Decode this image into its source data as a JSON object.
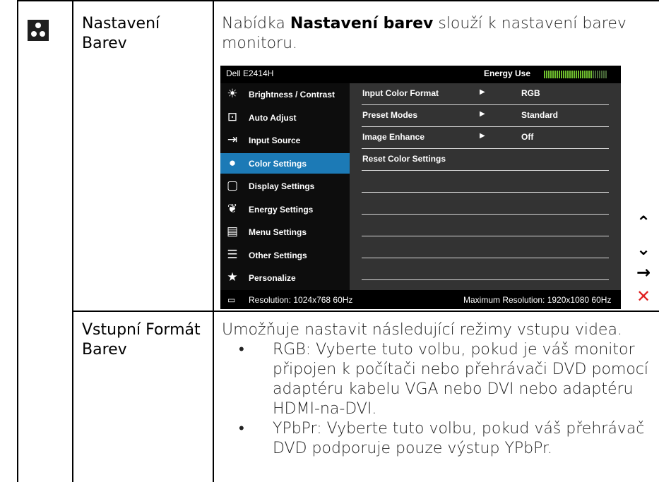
{
  "rows": [
    {
      "label": "Nastavení Barev",
      "desc_prefix": "Nabídka ",
      "desc_bold": "Nastavení barev",
      "desc_suffix": " slouží k nastavení barev monitoru."
    },
    {
      "label": "Vstupní Formát Barev",
      "desc_intro": "Umožňuje nastavit následující režimy vstupu videa.",
      "bullets": [
        "RGB: Vyberte tuto volbu, pokud je váš monitor připojen k počítači nebo přehrávači DVD pomocí adaptéru kabelu VGA nebo DVI nebo adaptéru HDMI-na-DVI.",
        "YPbPr: Vyberte tuto volbu, pokud váš přehrávač DVD podporuje pouze výstup YPbPr."
      ],
      "bullet_char": "•"
    }
  ],
  "icons": {
    "row_icon": "color-settings-icon"
  },
  "osd": {
    "model": "Dell E2414H",
    "energy_label": "Energy Use",
    "energy_level_fraction": 0.78,
    "menu": [
      {
        "label": "Brightness / Contrast",
        "icon": "brightness-icon",
        "glyph": "☀"
      },
      {
        "label": "Auto Adjust",
        "icon": "auto-adjust-icon",
        "glyph": "⊡"
      },
      {
        "label": "Input Source",
        "icon": "input-source-icon",
        "glyph": "⇥"
      },
      {
        "label": "Color Settings",
        "icon": "color-settings-icon",
        "glyph": "●"
      },
      {
        "label": "Display Settings",
        "icon": "display-settings-icon",
        "glyph": "▢"
      },
      {
        "label": "Energy Settings",
        "icon": "energy-settings-icon",
        "glyph": "❦"
      },
      {
        "label": "Menu Settings",
        "icon": "menu-settings-icon",
        "glyph": "▤"
      },
      {
        "label": "Other Settings",
        "icon": "other-settings-icon",
        "glyph": "☰"
      },
      {
        "label": "Personalize",
        "icon": "personalize-icon",
        "glyph": "★"
      }
    ],
    "selected_index": 3,
    "options": [
      {
        "label": "Input Color Format",
        "arrow": "▶",
        "value": "RGB"
      },
      {
        "label": "Preset Modes",
        "arrow": "▶",
        "value": "Standard"
      },
      {
        "label": "Image Enhance",
        "arrow": "▶",
        "value": "Off"
      },
      {
        "label": "Reset Color Settings",
        "arrow": "",
        "value": ""
      },
      {
        "label": "",
        "arrow": "",
        "value": ""
      },
      {
        "label": "",
        "arrow": "",
        "value": ""
      },
      {
        "label": "",
        "arrow": "",
        "value": ""
      },
      {
        "label": "",
        "arrow": "",
        "value": ""
      },
      {
        "label": "",
        "arrow": "",
        "value": ""
      }
    ],
    "resolution": "Resolution:  1024x768 60Hz",
    "max_resolution": "Maximum Resolution: 1920x1080 60Hz"
  },
  "side_buttons": [
    {
      "name": "up-button",
      "glyph": "⌃",
      "color": "#000000"
    },
    {
      "name": "down-button",
      "glyph": "⌄",
      "color": "#000000"
    },
    {
      "name": "enter-button",
      "glyph": "→",
      "color": "#000000"
    },
    {
      "name": "exit-button",
      "glyph": "✕",
      "color": "#e02020"
    }
  ],
  "colors": {
    "selected_menu": "#1c7ab6",
    "osd_panel": "#333333",
    "energy_meter": "#6fbf2e",
    "exit": "#e02020"
  }
}
